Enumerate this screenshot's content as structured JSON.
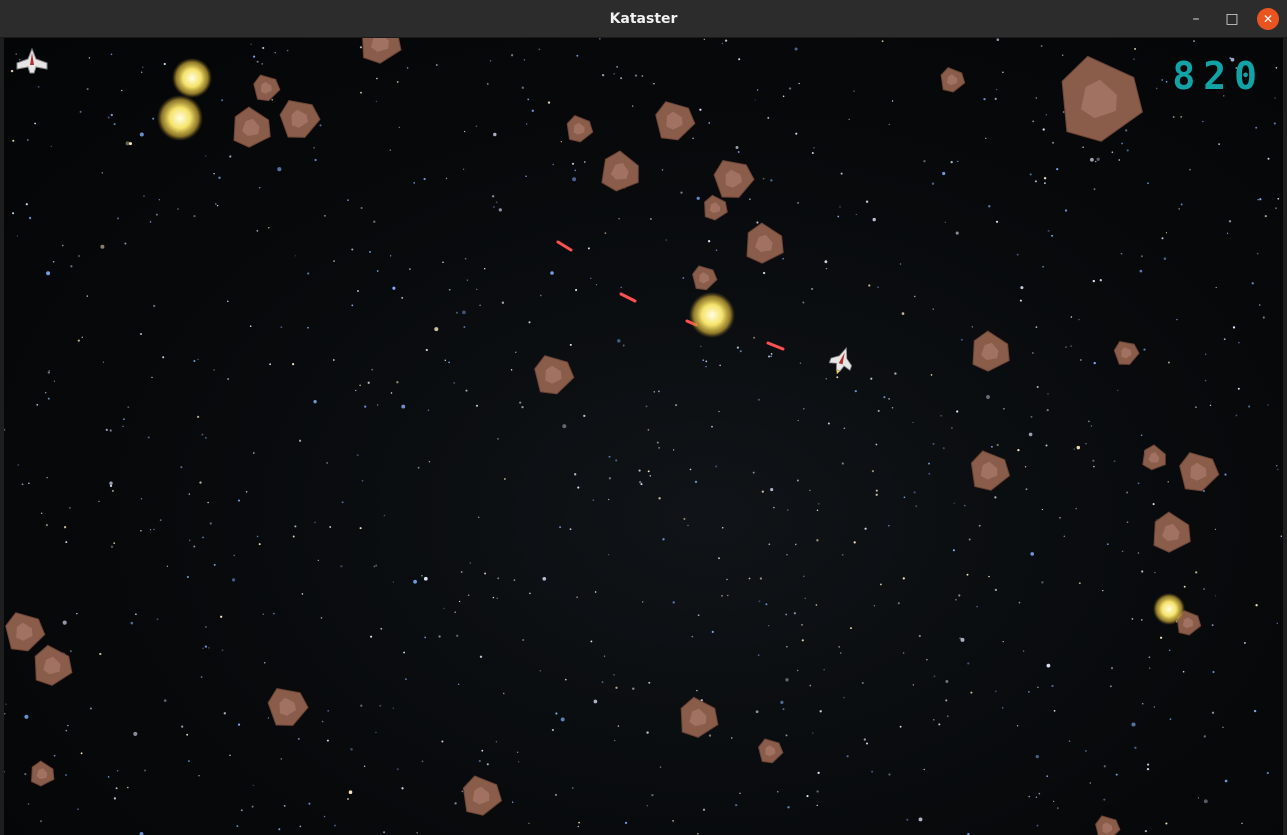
{
  "window": {
    "title": "Kataster",
    "controls": [
      "minimize",
      "maximize",
      "close"
    ]
  },
  "hud": {
    "score": "820",
    "lives": 1,
    "score_color": "#11a3a6"
  },
  "colors": {
    "asteroid": "#8a5c4a",
    "asteroid_inner": "#a67866",
    "laser": "#ff5050",
    "explosion": "#f5e36b",
    "close_button": "#e95420"
  },
  "icons": {
    "life": "spaceship-icon",
    "player": "spaceship-icon",
    "minimize": "minimize-icon",
    "maximize": "maximize-icon",
    "close": "close-icon"
  }
}
